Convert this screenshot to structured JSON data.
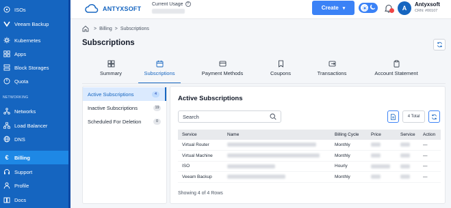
{
  "brand": {
    "name": "ANTYXSOFT",
    "color": "#1565c0",
    "accent": "#3b82f6"
  },
  "sidebar": {
    "items": [
      {
        "label": "ISOs",
        "icon": "disc-icon"
      },
      {
        "label": "Veeam Backup",
        "icon": "veeam-icon"
      },
      {
        "label": "Kubernetes",
        "icon": "kubernetes-icon"
      },
      {
        "label": "Apps",
        "icon": "grid-icon"
      },
      {
        "label": "Block Storages",
        "icon": "storage-icon"
      },
      {
        "label": "Quota",
        "icon": "gauge-icon"
      },
      {
        "label": "Networks",
        "icon": "network-icon"
      },
      {
        "label": "Load Balancer",
        "icon": "loadbalancer-icon"
      },
      {
        "label": "DNS",
        "icon": "globe-icon"
      },
      {
        "label": "Billing",
        "icon": "euro-icon"
      },
      {
        "label": "Support",
        "icon": "headset-icon"
      },
      {
        "label": "Profile",
        "icon": "user-icon"
      },
      {
        "label": "Docs",
        "icon": "docs-icon"
      }
    ],
    "section_networking": "NETWORKING",
    "active": "Billing"
  },
  "header": {
    "usage_label": "Current Usage",
    "create_label": "Create",
    "account_name": "Antyxsoft",
    "account_crn": "CRN: #00107"
  },
  "breadcrumb": {
    "first": "Billing",
    "second": "Subscriptions"
  },
  "page_title": "Subscriptions",
  "tabs": [
    {
      "label": "Summary",
      "icon": "grid-icon"
    },
    {
      "label": "Subscriptions",
      "icon": "calendar-icon"
    },
    {
      "label": "Payment Methods",
      "icon": "card-icon"
    },
    {
      "label": "Coupons",
      "icon": "bookmark-icon"
    },
    {
      "label": "Transactions",
      "icon": "transfer-icon"
    },
    {
      "label": "Account Statement",
      "icon": "clipboard-icon"
    }
  ],
  "filters": [
    {
      "label": "Active Subscriptions",
      "count": "4"
    },
    {
      "label": "Inactive Subscriptions",
      "count": "19"
    },
    {
      "label": "Scheduled For Deletion",
      "count": "0"
    }
  ],
  "panel": {
    "title": "Active Subscriptions",
    "search_placeholder": "Search",
    "total": "4 Total",
    "footer": "Showing 4 of 4 Rows"
  },
  "table": {
    "columns": [
      "Service",
      "Name",
      "Billing Cycle",
      "Price",
      "Service",
      "Action"
    ],
    "rows": [
      {
        "service": "Virtual Router",
        "cycle": "Monthly",
        "action": "—"
      },
      {
        "service": "Virtual Machine",
        "cycle": "Monthly",
        "action": "—"
      },
      {
        "service": "ISO",
        "cycle": "Hourly",
        "action": "—"
      },
      {
        "service": "Veeam Backup",
        "cycle": "Monthly",
        "action": "—"
      }
    ]
  }
}
